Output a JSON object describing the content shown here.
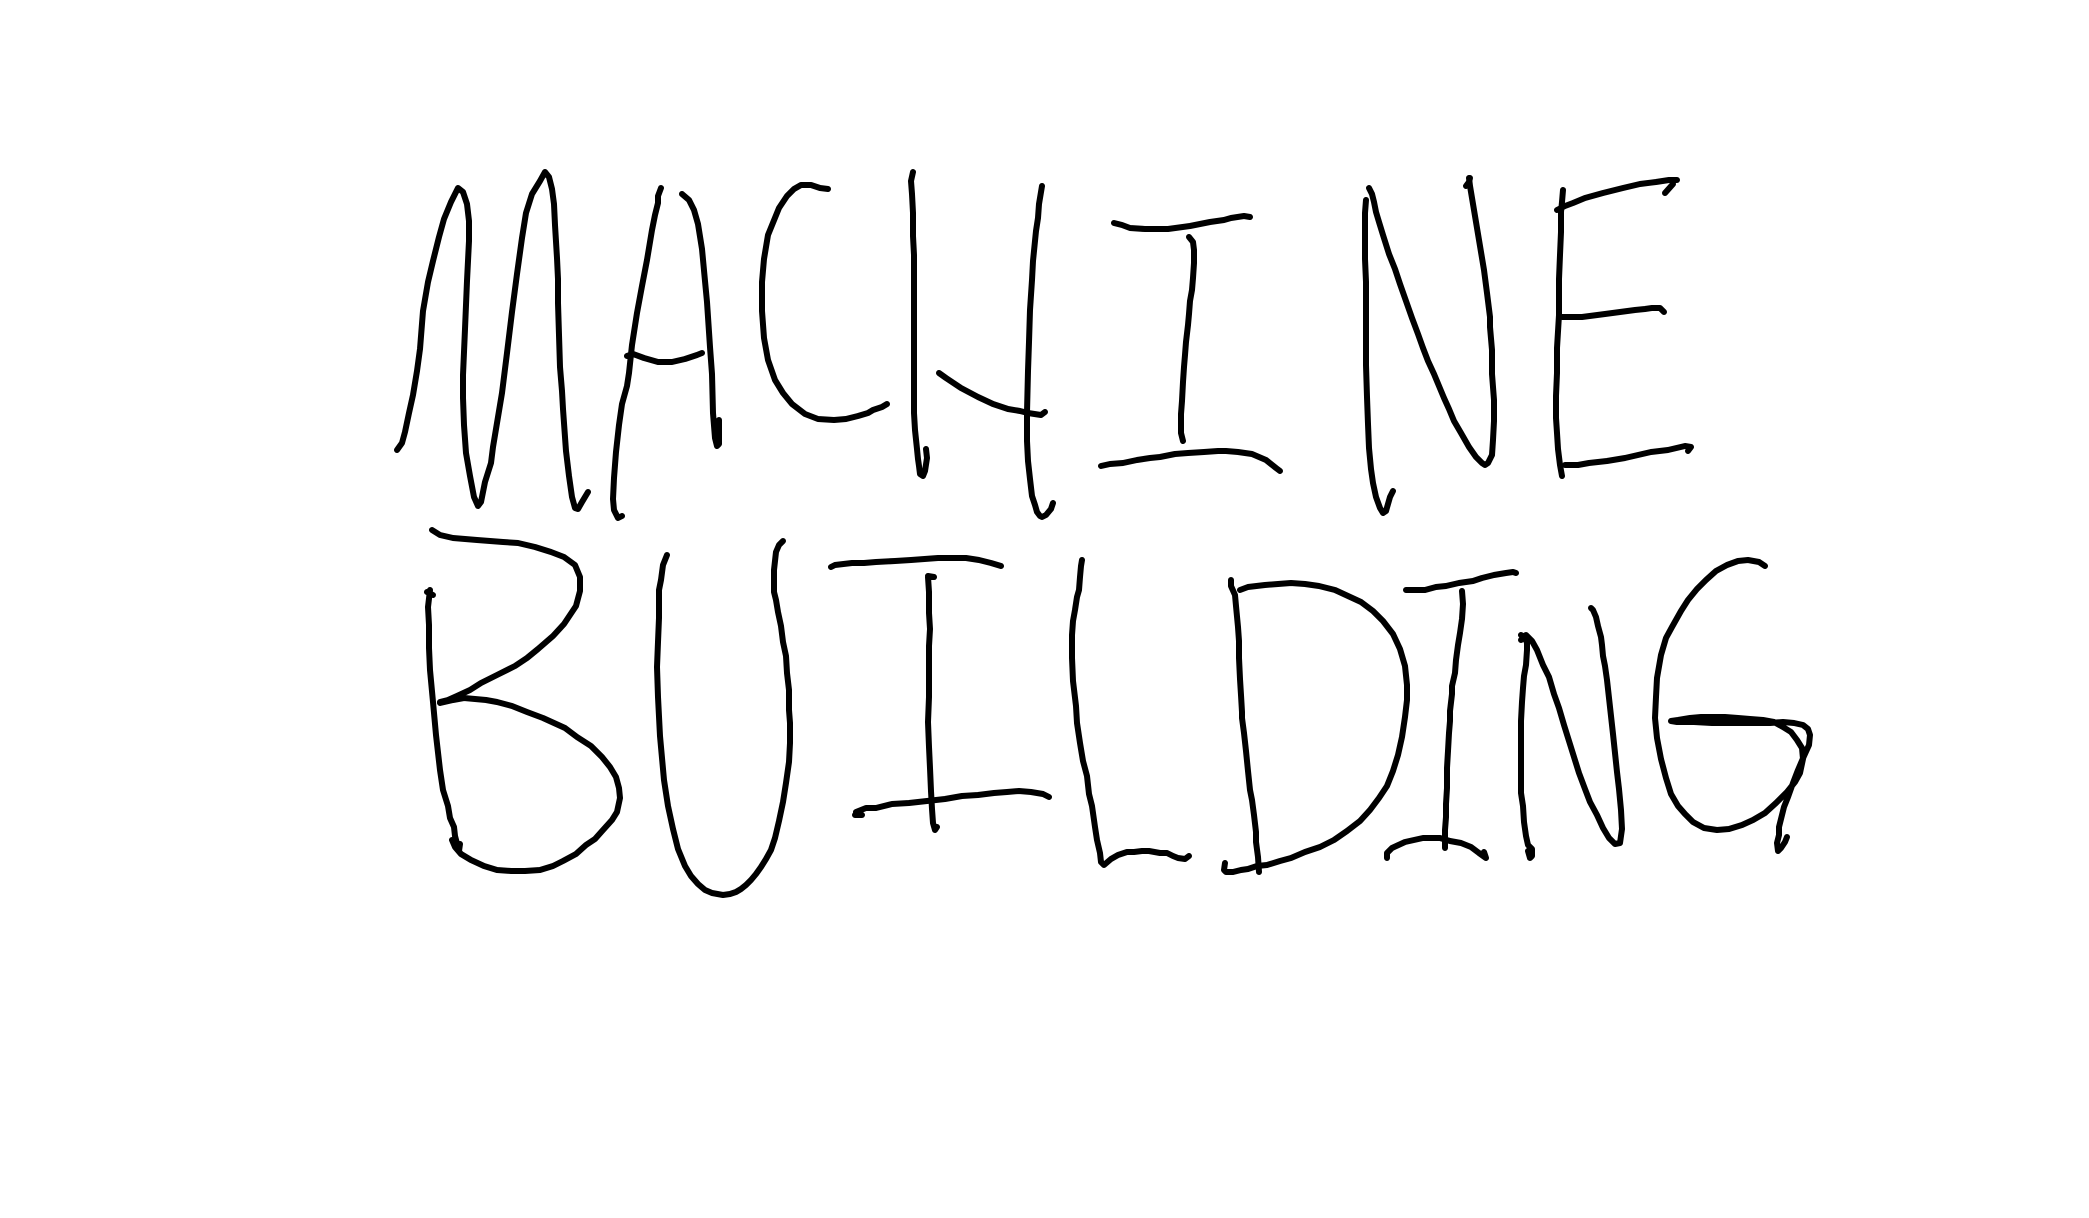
{
  "lines": [
    "MACHINE",
    "BUILDING"
  ],
  "ink_color": "#000000",
  "background_color": "#ffffff"
}
